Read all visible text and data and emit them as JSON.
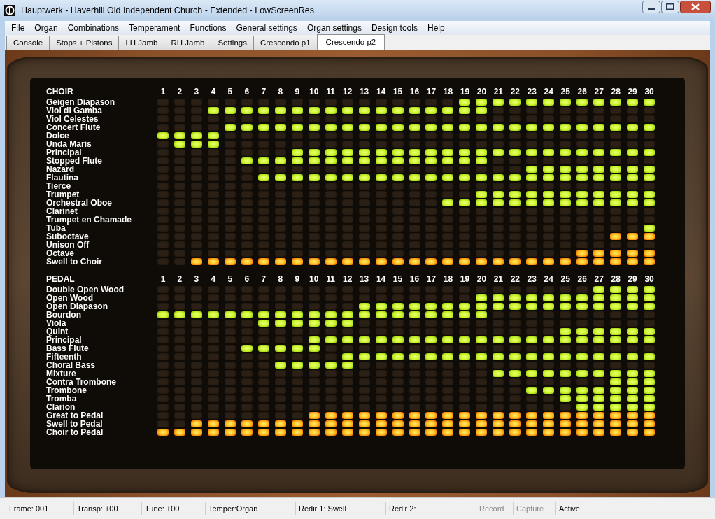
{
  "window": {
    "title": "Hauptwerk - Haverhill Old Independent Church - Extended - LowScreenRes"
  },
  "menu": [
    "File",
    "Organ",
    "Combinations",
    "Temperament",
    "Functions",
    "General settings",
    "Organ settings",
    "Design tools",
    "Help"
  ],
  "tabs": [
    {
      "label": "Console",
      "selected": false
    },
    {
      "label": "Stops + Pistons",
      "selected": false
    },
    {
      "label": "LH Jamb",
      "selected": false
    },
    {
      "label": "RH Jamb",
      "selected": false
    },
    {
      "label": "Settings",
      "selected": false
    },
    {
      "label": "Crescendo p1",
      "selected": false
    },
    {
      "label": "Crescendo p2",
      "selected": true
    }
  ],
  "sections": [
    {
      "title": "CHOIR",
      "columns": [
        "1",
        "2",
        "3",
        "4",
        "5",
        "6",
        "7",
        "8",
        "9",
        "10",
        "11",
        "12",
        "13",
        "14",
        "15",
        "16",
        "17",
        "18",
        "19",
        "20",
        "21",
        "22",
        "23",
        "24",
        "25",
        "26",
        "27",
        "28",
        "29",
        "30"
      ],
      "rows": [
        {
          "name": "Geigen Diapason",
          "kind": "stop",
          "lit": [
            false,
            false,
            false,
            false,
            false,
            false,
            false,
            false,
            false,
            false,
            false,
            false,
            false,
            false,
            false,
            false,
            false,
            false,
            true,
            true,
            true,
            true,
            true,
            true,
            true,
            true,
            true,
            true,
            true,
            true
          ]
        },
        {
          "name": "Viol di Gamba",
          "kind": "stop",
          "lit": [
            false,
            false,
            false,
            true,
            true,
            true,
            true,
            true,
            true,
            true,
            true,
            true,
            true,
            true,
            true,
            true,
            true,
            true,
            true,
            true,
            false,
            false,
            false,
            false,
            false,
            false,
            false,
            false,
            false,
            false
          ]
        },
        {
          "name": "Viol Celestes",
          "kind": "stop",
          "lit": [
            false,
            false,
            false,
            false,
            false,
            false,
            false,
            false,
            false,
            false,
            false,
            false,
            false,
            false,
            false,
            false,
            false,
            false,
            false,
            false,
            false,
            false,
            false,
            false,
            false,
            false,
            false,
            false,
            false,
            false
          ]
        },
        {
          "name": "Concert Flute",
          "kind": "stop",
          "lit": [
            false,
            false,
            false,
            false,
            true,
            true,
            true,
            true,
            true,
            true,
            true,
            true,
            true,
            true,
            true,
            true,
            true,
            true,
            true,
            true,
            true,
            true,
            true,
            true,
            true,
            true,
            true,
            true,
            true,
            true
          ]
        },
        {
          "name": "Dolce",
          "kind": "stop",
          "lit": [
            true,
            true,
            true,
            true,
            false,
            false,
            false,
            false,
            false,
            false,
            false,
            false,
            false,
            false,
            false,
            false,
            false,
            false,
            false,
            false,
            false,
            false,
            false,
            false,
            false,
            false,
            false,
            false,
            false,
            false
          ]
        },
        {
          "name": "Unda Maris",
          "kind": "stop",
          "lit": [
            false,
            true,
            true,
            true,
            false,
            false,
            false,
            false,
            false,
            false,
            false,
            false,
            false,
            false,
            false,
            false,
            false,
            false,
            false,
            false,
            false,
            false,
            false,
            false,
            false,
            false,
            false,
            false,
            false,
            false
          ]
        },
        {
          "name": "Principal",
          "kind": "stop",
          "lit": [
            false,
            false,
            false,
            false,
            false,
            false,
            false,
            false,
            true,
            true,
            true,
            true,
            true,
            true,
            true,
            true,
            true,
            true,
            true,
            true,
            true,
            true,
            true,
            true,
            true,
            true,
            true,
            true,
            true,
            true
          ]
        },
        {
          "name": "Stopped Flute",
          "kind": "stop",
          "lit": [
            false,
            false,
            false,
            false,
            false,
            true,
            true,
            true,
            true,
            true,
            true,
            true,
            true,
            true,
            true,
            true,
            true,
            true,
            true,
            true,
            false,
            false,
            false,
            false,
            false,
            false,
            false,
            false,
            false,
            false
          ]
        },
        {
          "name": "Nazard",
          "kind": "stop",
          "lit": [
            false,
            false,
            false,
            false,
            false,
            false,
            false,
            false,
            false,
            false,
            false,
            false,
            false,
            false,
            false,
            false,
            false,
            false,
            false,
            false,
            false,
            false,
            true,
            true,
            true,
            true,
            true,
            true,
            true,
            true
          ]
        },
        {
          "name": "Flautina",
          "kind": "stop",
          "lit": [
            false,
            false,
            false,
            false,
            false,
            false,
            true,
            true,
            true,
            true,
            true,
            true,
            true,
            true,
            true,
            true,
            true,
            true,
            true,
            true,
            true,
            true,
            true,
            true,
            true,
            true,
            true,
            true,
            true,
            true
          ]
        },
        {
          "name": "Tierce",
          "kind": "stop",
          "lit": [
            false,
            false,
            false,
            false,
            false,
            false,
            false,
            false,
            false,
            false,
            false,
            false,
            false,
            false,
            false,
            false,
            false,
            false,
            false,
            false,
            false,
            false,
            false,
            false,
            false,
            false,
            false,
            false,
            false,
            false
          ]
        },
        {
          "name": "Trumpet",
          "kind": "stop",
          "lit": [
            false,
            false,
            false,
            false,
            false,
            false,
            false,
            false,
            false,
            false,
            false,
            false,
            false,
            false,
            false,
            false,
            false,
            false,
            false,
            true,
            true,
            true,
            true,
            true,
            true,
            true,
            true,
            true,
            true,
            true
          ]
        },
        {
          "name": "Orchestral Oboe",
          "kind": "stop",
          "lit": [
            false,
            false,
            false,
            false,
            false,
            false,
            false,
            false,
            false,
            false,
            false,
            false,
            false,
            false,
            false,
            false,
            false,
            true,
            true,
            true,
            true,
            true,
            true,
            true,
            true,
            true,
            true,
            true,
            true,
            true
          ]
        },
        {
          "name": "Clarinet",
          "kind": "stop",
          "lit": [
            false,
            false,
            false,
            false,
            false,
            false,
            false,
            false,
            false,
            false,
            false,
            false,
            false,
            false,
            false,
            false,
            false,
            false,
            false,
            false,
            false,
            false,
            false,
            false,
            false,
            false,
            false,
            false,
            false,
            false
          ]
        },
        {
          "name": "Trumpet en Chamade",
          "kind": "stop",
          "lit": [
            false,
            false,
            false,
            false,
            false,
            false,
            false,
            false,
            false,
            false,
            false,
            false,
            false,
            false,
            false,
            false,
            false,
            false,
            false,
            false,
            false,
            false,
            false,
            false,
            false,
            false,
            false,
            false,
            false,
            false
          ]
        },
        {
          "name": "Tuba",
          "kind": "stop",
          "lit": [
            false,
            false,
            false,
            false,
            false,
            false,
            false,
            false,
            false,
            false,
            false,
            false,
            false,
            false,
            false,
            false,
            false,
            false,
            false,
            false,
            false,
            false,
            false,
            false,
            false,
            false,
            false,
            false,
            false,
            true
          ]
        },
        {
          "name": "Suboctave",
          "kind": "coupler",
          "lit": [
            false,
            false,
            false,
            false,
            false,
            false,
            false,
            false,
            false,
            false,
            false,
            false,
            false,
            false,
            false,
            false,
            false,
            false,
            false,
            false,
            false,
            false,
            false,
            false,
            false,
            false,
            false,
            true,
            true,
            true
          ]
        },
        {
          "name": "Unison Off",
          "kind": "coupler",
          "lit": [
            false,
            false,
            false,
            false,
            false,
            false,
            false,
            false,
            false,
            false,
            false,
            false,
            false,
            false,
            false,
            false,
            false,
            false,
            false,
            false,
            false,
            false,
            false,
            false,
            false,
            false,
            false,
            false,
            false,
            false
          ]
        },
        {
          "name": "Octave",
          "kind": "coupler",
          "lit": [
            false,
            false,
            false,
            false,
            false,
            false,
            false,
            false,
            false,
            false,
            false,
            false,
            false,
            false,
            false,
            false,
            false,
            false,
            false,
            false,
            false,
            false,
            false,
            false,
            false,
            true,
            true,
            true,
            true,
            true
          ]
        },
        {
          "name": "Swell to Choir",
          "kind": "coupler",
          "lit": [
            false,
            false,
            true,
            true,
            true,
            true,
            true,
            true,
            true,
            true,
            true,
            true,
            true,
            true,
            true,
            true,
            true,
            true,
            true,
            true,
            true,
            true,
            true,
            true,
            true,
            true,
            true,
            true,
            true,
            true
          ]
        }
      ]
    },
    {
      "title": "PEDAL",
      "columns": [
        "1",
        "2",
        "3",
        "4",
        "5",
        "6",
        "7",
        "8",
        "9",
        "10",
        "11",
        "12",
        "13",
        "14",
        "15",
        "16",
        "17",
        "18",
        "19",
        "20",
        "21",
        "22",
        "23",
        "24",
        "25",
        "26",
        "27",
        "28",
        "29",
        "30"
      ],
      "rows": [
        {
          "name": "Double Open Wood",
          "kind": "stop",
          "lit": [
            false,
            false,
            false,
            false,
            false,
            false,
            false,
            false,
            false,
            false,
            false,
            false,
            false,
            false,
            false,
            false,
            false,
            false,
            false,
            false,
            false,
            false,
            false,
            false,
            false,
            false,
            true,
            true,
            true,
            true
          ]
        },
        {
          "name": "Open Wood",
          "kind": "stop",
          "lit": [
            false,
            false,
            false,
            false,
            false,
            false,
            false,
            false,
            false,
            false,
            false,
            false,
            false,
            false,
            false,
            false,
            false,
            false,
            false,
            true,
            true,
            true,
            true,
            true,
            true,
            true,
            true,
            true,
            true,
            true
          ]
        },
        {
          "name": "Open Diapason",
          "kind": "stop",
          "lit": [
            false,
            false,
            false,
            false,
            false,
            false,
            false,
            false,
            false,
            false,
            false,
            false,
            true,
            true,
            true,
            true,
            true,
            true,
            true,
            true,
            true,
            true,
            true,
            true,
            true,
            true,
            true,
            true,
            true,
            true
          ]
        },
        {
          "name": "Bourdon",
          "kind": "stop",
          "lit": [
            true,
            true,
            true,
            true,
            true,
            true,
            true,
            true,
            true,
            true,
            true,
            true,
            true,
            true,
            true,
            true,
            true,
            true,
            true,
            true,
            false,
            false,
            false,
            false,
            false,
            false,
            false,
            false,
            false,
            false
          ]
        },
        {
          "name": "Viola",
          "kind": "stop",
          "lit": [
            false,
            false,
            false,
            false,
            false,
            false,
            true,
            true,
            true,
            true,
            true,
            true,
            false,
            false,
            false,
            false,
            false,
            false,
            false,
            false,
            false,
            false,
            false,
            false,
            false,
            false,
            false,
            false,
            false,
            false
          ]
        },
        {
          "name": "Quint",
          "kind": "stop",
          "lit": [
            false,
            false,
            false,
            false,
            false,
            false,
            false,
            false,
            false,
            false,
            false,
            false,
            false,
            false,
            false,
            false,
            false,
            false,
            false,
            false,
            false,
            false,
            false,
            false,
            true,
            true,
            true,
            true,
            true,
            true
          ]
        },
        {
          "name": "Principal",
          "kind": "stop",
          "lit": [
            false,
            false,
            false,
            false,
            false,
            false,
            false,
            false,
            false,
            true,
            true,
            true,
            true,
            true,
            true,
            true,
            true,
            true,
            true,
            true,
            true,
            true,
            true,
            true,
            true,
            true,
            true,
            true,
            true,
            true
          ]
        },
        {
          "name": "Bass Flute",
          "kind": "stop",
          "lit": [
            false,
            false,
            false,
            false,
            false,
            true,
            true,
            true,
            true,
            true,
            false,
            false,
            false,
            false,
            false,
            false,
            false,
            false,
            false,
            false,
            false,
            false,
            false,
            false,
            false,
            false,
            false,
            false,
            false,
            false
          ]
        },
        {
          "name": "Fifteenth",
          "kind": "stop",
          "lit": [
            false,
            false,
            false,
            false,
            false,
            false,
            false,
            false,
            false,
            false,
            false,
            true,
            true,
            true,
            true,
            true,
            true,
            true,
            true,
            true,
            true,
            true,
            true,
            true,
            true,
            true,
            true,
            true,
            true,
            true
          ]
        },
        {
          "name": "Choral Bass",
          "kind": "stop",
          "lit": [
            false,
            false,
            false,
            false,
            false,
            false,
            false,
            true,
            true,
            true,
            true,
            true,
            false,
            false,
            false,
            false,
            false,
            false,
            false,
            false,
            false,
            false,
            false,
            false,
            false,
            false,
            false,
            false,
            false,
            false
          ]
        },
        {
          "name": "Mixture",
          "kind": "stop",
          "lit": [
            false,
            false,
            false,
            false,
            false,
            false,
            false,
            false,
            false,
            false,
            false,
            false,
            false,
            false,
            false,
            false,
            false,
            false,
            false,
            false,
            true,
            true,
            true,
            true,
            true,
            true,
            true,
            true,
            true,
            true
          ]
        },
        {
          "name": "Contra Trombone",
          "kind": "stop",
          "lit": [
            false,
            false,
            false,
            false,
            false,
            false,
            false,
            false,
            false,
            false,
            false,
            false,
            false,
            false,
            false,
            false,
            false,
            false,
            false,
            false,
            false,
            false,
            false,
            false,
            false,
            false,
            false,
            true,
            true,
            true
          ]
        },
        {
          "name": "Trombone",
          "kind": "stop",
          "lit": [
            false,
            false,
            false,
            false,
            false,
            false,
            false,
            false,
            false,
            false,
            false,
            false,
            false,
            false,
            false,
            false,
            false,
            false,
            false,
            false,
            false,
            false,
            true,
            true,
            true,
            true,
            true,
            true,
            true,
            true
          ]
        },
        {
          "name": "Tromba",
          "kind": "stop",
          "lit": [
            false,
            false,
            false,
            false,
            false,
            false,
            false,
            false,
            false,
            false,
            false,
            false,
            false,
            false,
            false,
            false,
            false,
            false,
            false,
            false,
            false,
            false,
            false,
            false,
            true,
            true,
            true,
            true,
            true,
            true
          ]
        },
        {
          "name": "Clarion",
          "kind": "stop",
          "lit": [
            false,
            false,
            false,
            false,
            false,
            false,
            false,
            false,
            false,
            false,
            false,
            false,
            false,
            false,
            false,
            false,
            false,
            false,
            false,
            false,
            false,
            false,
            false,
            false,
            false,
            true,
            true,
            true,
            true,
            true
          ]
        },
        {
          "name": "Great to Pedal",
          "kind": "coupler",
          "lit": [
            false,
            false,
            false,
            false,
            false,
            false,
            false,
            false,
            false,
            true,
            true,
            true,
            true,
            true,
            true,
            true,
            true,
            true,
            true,
            true,
            true,
            true,
            true,
            true,
            true,
            true,
            true,
            true,
            true,
            true
          ]
        },
        {
          "name": "Swell to Pedal",
          "kind": "coupler",
          "lit": [
            false,
            false,
            true,
            true,
            true,
            true,
            true,
            true,
            true,
            true,
            true,
            true,
            true,
            true,
            true,
            true,
            true,
            true,
            true,
            true,
            true,
            true,
            true,
            true,
            true,
            true,
            true,
            true,
            true,
            true
          ]
        },
        {
          "name": "Choir to Pedal",
          "kind": "coupler",
          "lit": [
            true,
            true,
            true,
            true,
            true,
            true,
            true,
            true,
            true,
            true,
            true,
            true,
            true,
            true,
            true,
            true,
            true,
            true,
            true,
            true,
            true,
            true,
            true,
            true,
            true,
            true,
            true,
            true,
            true,
            true
          ]
        }
      ]
    }
  ],
  "status_bar": [
    {
      "text": "Frame: 001",
      "disabled": false
    },
    {
      "text": "Transp: +00",
      "disabled": false
    },
    {
      "text": "Tune: +00",
      "disabled": false
    },
    {
      "text": "Temper:Organ",
      "disabled": false
    },
    {
      "text": "Redir 1: Swell",
      "disabled": false
    },
    {
      "text": "Redir 2:",
      "disabled": false
    },
    {
      "text": "Record",
      "disabled": true
    },
    {
      "text": "Capture",
      "disabled": true
    },
    {
      "text": "Active",
      "disabled": false
    }
  ]
}
